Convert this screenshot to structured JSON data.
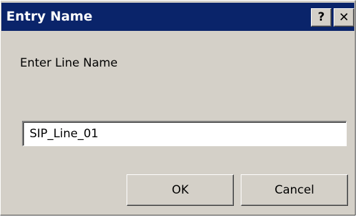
{
  "window": {
    "title": "Entry Name",
    "help_glyph": "?",
    "close_glyph": "✕",
    "help_icon": "help-icon",
    "close_icon": "close-icon",
    "titlebar_color": "#0a246a",
    "face_color": "#d4d0c8"
  },
  "form": {
    "prompt": "Enter Line Name",
    "line_name_value": "SIP_Line_01"
  },
  "buttons": {
    "ok_label": "OK",
    "cancel_label": "Cancel"
  }
}
